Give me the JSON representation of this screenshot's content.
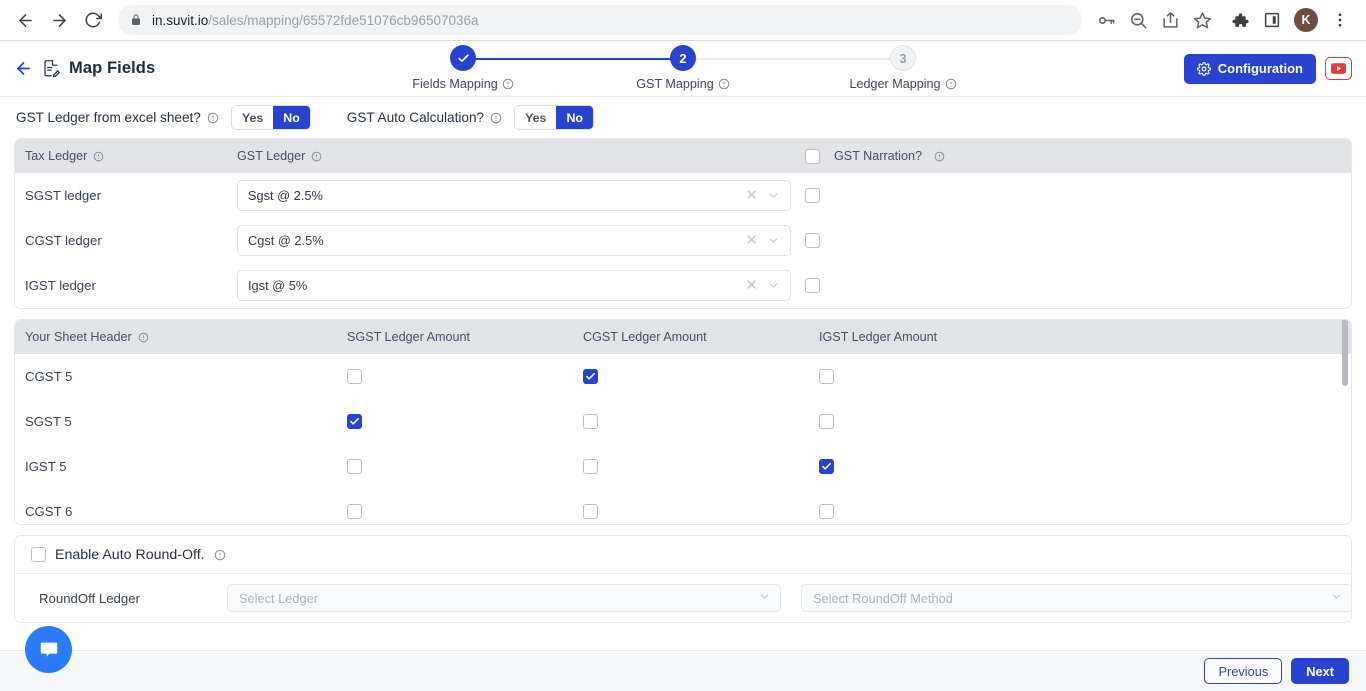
{
  "browser": {
    "back_icon": "back-arrow-icon",
    "forward_icon": "forward-arrow-icon",
    "reload_icon": "reload-icon",
    "lock_icon": "lock-icon",
    "url_domain": "in.suvit.io",
    "url_path": "/sales/mapping/65572fde51076cb96507036a",
    "toolbar_icons": [
      "password-key-icon",
      "zoom-out-icon",
      "share-icon",
      "bookmark-star-icon",
      "extensions-puzzle-icon",
      "split-screen-icon"
    ],
    "profile_initial": "K",
    "menu_icon": "kebab-menu-icon"
  },
  "header": {
    "back_label": "back",
    "doc_icon": "document-edit-icon",
    "title": "Map Fields",
    "configuration_label": "Configuration",
    "gear_icon": "gear-icon",
    "youtube_icon": "youtube-icon"
  },
  "stepper": {
    "steps": [
      {
        "badge": "✓",
        "label": "Fields Mapping",
        "state": "done"
      },
      {
        "badge": "2",
        "label": "GST Mapping",
        "state": "active"
      },
      {
        "badge": "3",
        "label": "Ledger Mapping",
        "state": "todo"
      }
    ],
    "info_icon": "info-icon"
  },
  "toggles": [
    {
      "label": "GST Ledger from excel sheet?",
      "yes": "Yes",
      "no": "No",
      "selected": "No"
    },
    {
      "label": "GST Auto Calculation?",
      "yes": "Yes",
      "no": "No",
      "selected": "No"
    }
  ],
  "ledger_table": {
    "headers": {
      "tax_ledger": "Tax Ledger",
      "gst_ledger": "GST Ledger",
      "gst_narration": "GST Narration?",
      "narration_all_checked": false
    },
    "rows": [
      {
        "label": "SGST ledger",
        "value": "Sgst @ 2.5%",
        "narration": false
      },
      {
        "label": "CGST ledger",
        "value": "Cgst @ 2.5%",
        "narration": false
      },
      {
        "label": "IGST ledger",
        "value": "Igst @ 5%",
        "narration": false
      }
    ],
    "clear_icon": "clear-x-icon",
    "chevron_icon": "chevron-down-icon"
  },
  "matrix_table": {
    "headers": [
      "Your Sheet Header",
      "SGST Ledger Amount",
      "CGST Ledger Amount",
      "IGST Ledger Amount"
    ],
    "rows": [
      {
        "label": "CGST 5",
        "sgst": false,
        "cgst": true,
        "igst": false
      },
      {
        "label": "SGST 5",
        "sgst": true,
        "cgst": false,
        "igst": false
      },
      {
        "label": "IGST 5",
        "sgst": false,
        "cgst": false,
        "igst": true
      },
      {
        "label": "CGST 6",
        "sgst": false,
        "cgst": false,
        "igst": false
      }
    ]
  },
  "roundoff": {
    "enable_label": "Enable Auto Round-Off.",
    "enabled": false,
    "ledger_label": "RoundOff Ledger",
    "ledger_placeholder": "Select Ledger",
    "method_placeholder": "Select RoundOff Method"
  },
  "footer": {
    "previous": "Previous",
    "next": "Next"
  },
  "chat": {
    "icon": "chat-bubble-icon"
  }
}
